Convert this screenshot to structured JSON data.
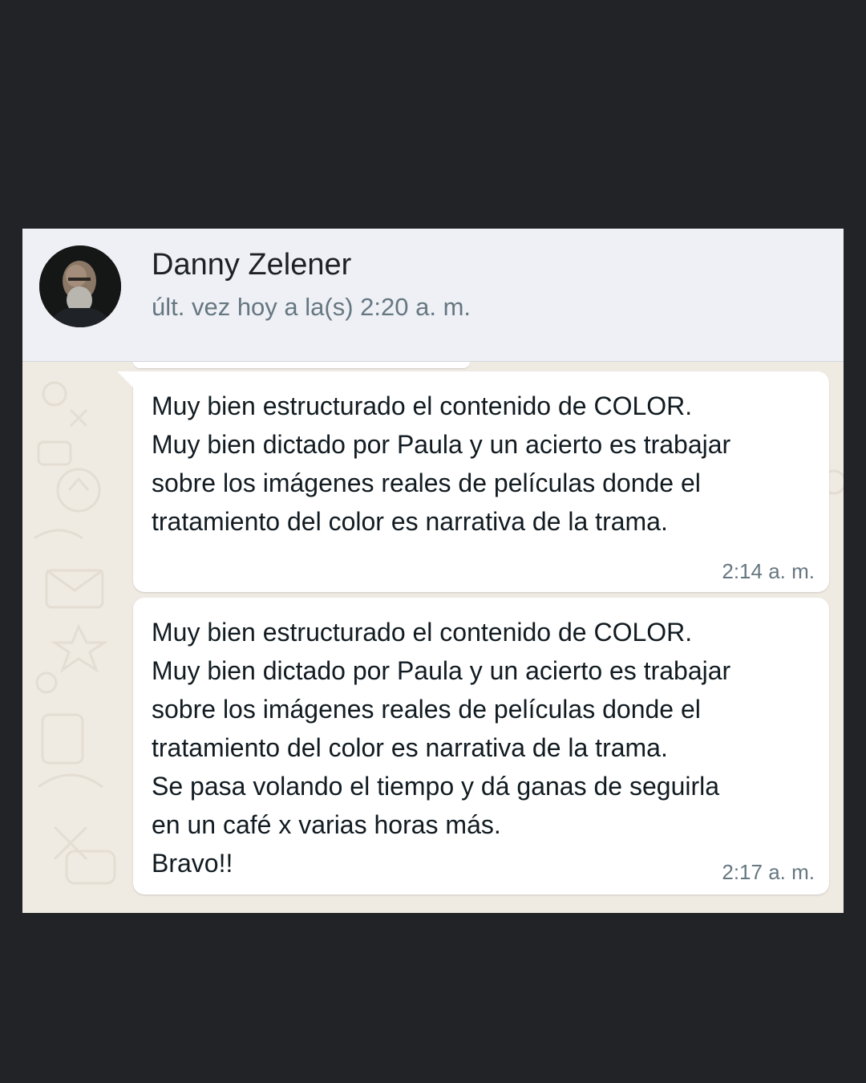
{
  "header": {
    "contact_name": "Danny Zelener",
    "status": "últ. vez hoy a la(s) 2:20 a. m.",
    "avatar_icon": "profile-photo"
  },
  "messages": [
    {
      "text": "Muy bien estructurado el contenido de COLOR.\nMuy bien dictado por Paula y un acierto es trabajar\nsobre los imágenes reales de películas donde el\ntratamiento del color es narrativa de la trama.",
      "time": "2:14 a. m."
    },
    {
      "text": "Muy bien estructurado el contenido de COLOR.\nMuy bien dictado por Paula y un acierto es trabajar\nsobre los imágenes reales de películas donde el\ntratamiento del color es narrativa de la trama.\nSe pasa volando el tiempo y dá ganas de seguirla\nen un café x varias horas más.\nBravo!!",
      "time": "2:17 a. m."
    }
  ],
  "colors": {
    "background": "#222326",
    "header_bg": "#eef0f5",
    "chat_bg": "#efeae2",
    "bubble_bg": "#ffffff",
    "text": "#111b21",
    "meta_text": "#667781"
  }
}
